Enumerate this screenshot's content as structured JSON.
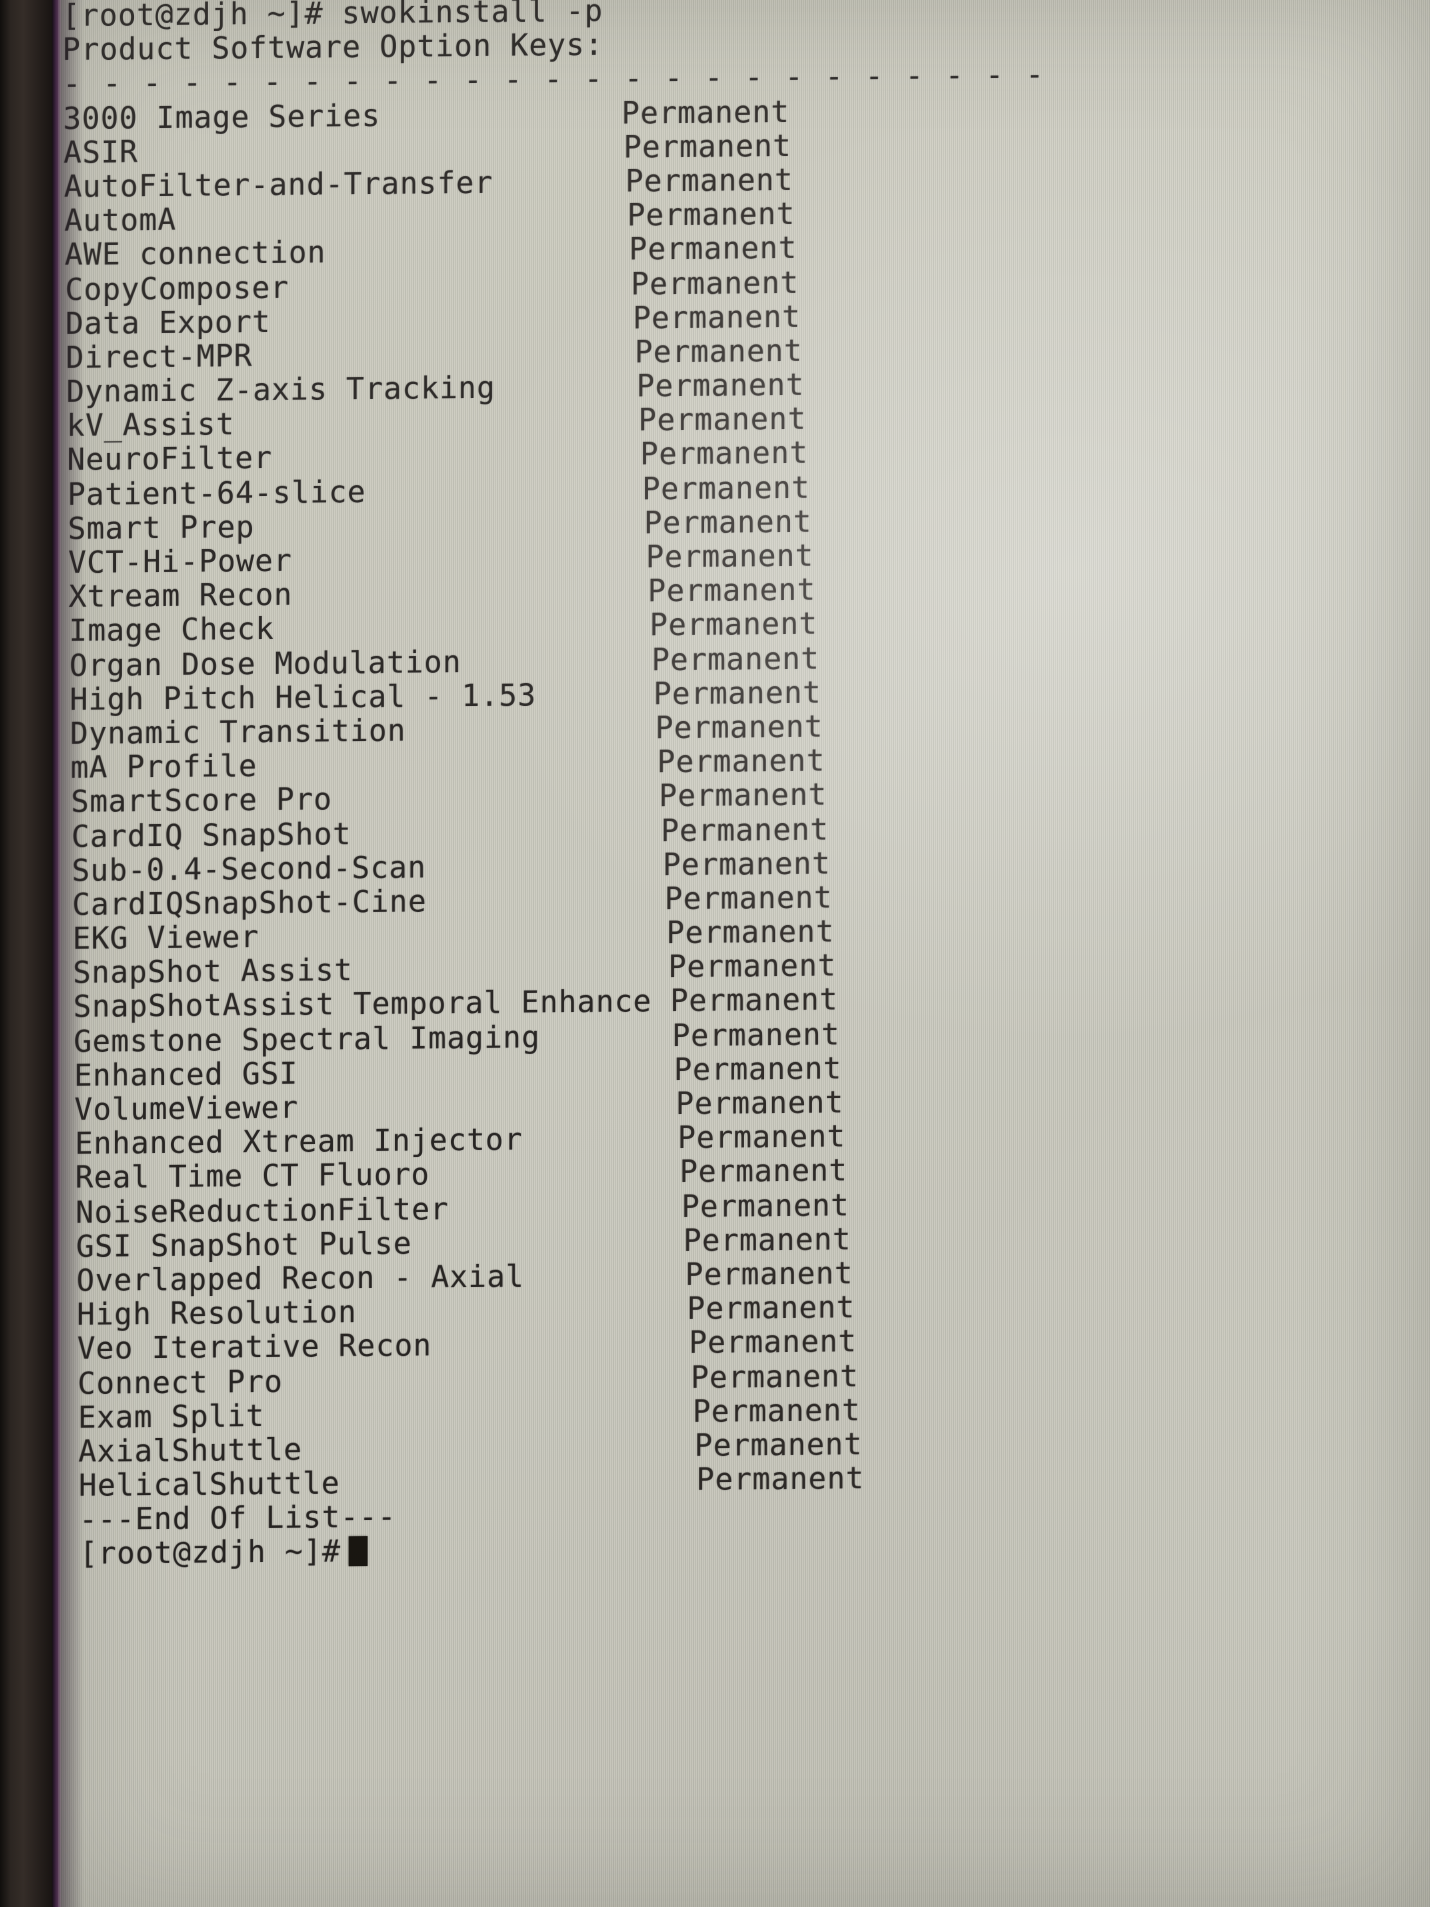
{
  "meta": {
    "screen_kind": "linux-terminal-photo",
    "bezel_color": "#2b2521",
    "screen_color": "#cfcec3",
    "text_color": "#24211f"
  },
  "terminal": {
    "command_line": "[root@zdjh ~]# swokinstall -p",
    "heading": "Product Software Option Keys:",
    "separator": "- - - - - - - - - - - - - - - - - - - - - - - - -",
    "status_label": "Permanent",
    "end_of_list": "---End Of List---",
    "final_prompt": "[root@zdjh ~]#",
    "cursor": "block-cursor",
    "options": [
      {
        "name": "3000 Image Series",
        "status": "Permanent"
      },
      {
        "name": "ASIR",
        "status": "Permanent"
      },
      {
        "name": "AutoFilter-and-Transfer",
        "status": "Permanent"
      },
      {
        "name": "AutomA",
        "status": "Permanent"
      },
      {
        "name": "AWE connection",
        "status": "Permanent"
      },
      {
        "name": "CopyComposer",
        "status": "Permanent"
      },
      {
        "name": "Data Export",
        "status": "Permanent"
      },
      {
        "name": "Direct-MPR",
        "status": "Permanent"
      },
      {
        "name": "Dynamic Z-axis Tracking",
        "status": "Permanent"
      },
      {
        "name": "kV_Assist",
        "status": "Permanent"
      },
      {
        "name": "NeuroFilter",
        "status": "Permanent"
      },
      {
        "name": "Patient-64-slice",
        "status": "Permanent"
      },
      {
        "name": "Smart Prep",
        "status": "Permanent"
      },
      {
        "name": "VCT-Hi-Power",
        "status": "Permanent"
      },
      {
        "name": "Xtream Recon",
        "status": "Permanent"
      },
      {
        "name": "Image Check",
        "status": "Permanent"
      },
      {
        "name": "Organ Dose Modulation",
        "status": "Permanent"
      },
      {
        "name": "High Pitch Helical - 1.53",
        "status": "Permanent"
      },
      {
        "name": "Dynamic Transition",
        "status": "Permanent"
      },
      {
        "name": "mA Profile",
        "status": "Permanent"
      },
      {
        "name": "SmartScore Pro",
        "status": "Permanent"
      },
      {
        "name": "CardIQ SnapShot",
        "status": "Permanent"
      },
      {
        "name": "Sub-0.4-Second-Scan",
        "status": "Permanent"
      },
      {
        "name": "CardIQSnapShot-Cine",
        "status": "Permanent"
      },
      {
        "name": "EKG Viewer",
        "status": "Permanent"
      },
      {
        "name": "SnapShot Assist",
        "status": "Permanent"
      },
      {
        "name": "SnapShotAssist Temporal Enhance",
        "status": "Permanent"
      },
      {
        "name": "Gemstone Spectral Imaging",
        "status": "Permanent"
      },
      {
        "name": "Enhanced GSI",
        "status": "Permanent"
      },
      {
        "name": "VolumeViewer",
        "status": "Permanent"
      },
      {
        "name": "Enhanced Xtream Injector",
        "status": "Permanent"
      },
      {
        "name": "Real Time CT Fluoro",
        "status": "Permanent"
      },
      {
        "name": "NoiseReductionFilter",
        "status": "Permanent"
      },
      {
        "name": "GSI SnapShot Pulse",
        "status": "Permanent"
      },
      {
        "name": "Overlapped Recon - Axial",
        "status": "Permanent"
      },
      {
        "name": "High Resolution",
        "status": "Permanent"
      },
      {
        "name": "Veo Iterative Recon",
        "status": "Permanent"
      },
      {
        "name": "Connect Pro",
        "status": "Permanent"
      },
      {
        "name": "Exam Split",
        "status": "Permanent"
      },
      {
        "name": "AxialShuttle",
        "status": "Permanent"
      },
      {
        "name": "HelicalShuttle",
        "status": "Permanent"
      }
    ]
  }
}
